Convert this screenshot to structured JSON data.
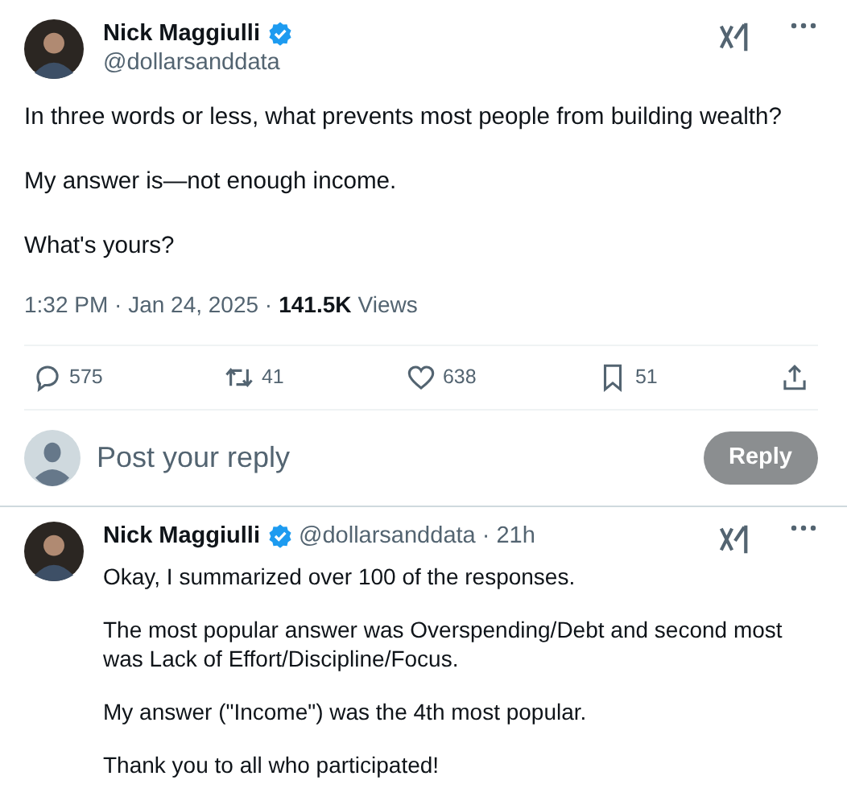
{
  "tweet": {
    "author": {
      "name": "Nick Maggiulli",
      "verified": true,
      "handle": "@dollarsanddata"
    },
    "paragraphs": [
      "In three words or less, what prevents most people from building wealth?",
      "My answer is—not enough income.",
      "What's yours?"
    ],
    "timestamp": "1:32 PM · Jan 24, 2025 ·",
    "views_count": "141.5K",
    "views_label": "Views",
    "actions": [
      {
        "kind": "reply",
        "count": "575"
      },
      {
        "kind": "repost",
        "count": "41"
      },
      {
        "kind": "like",
        "count": "638"
      },
      {
        "kind": "bookmark",
        "count": "51"
      },
      {
        "kind": "share"
      }
    ]
  },
  "composer": {
    "placeholder": "Post your reply",
    "button": "Reply",
    "disabled": true
  },
  "reply": {
    "author": {
      "name": "Nick Maggiulli",
      "verified": true,
      "handle": "@dollarsanddata"
    },
    "time": "· 21h",
    "paragraphs": [
      "Okay, I summarized over 100 of the responses.",
      "The most popular answer was Overspending/Debt and second most was Lack of Effort/Discipline/Focus.",
      "My answer (\"Income\") was the 4th most popular.",
      "Thank you to all who participated!"
    ]
  }
}
